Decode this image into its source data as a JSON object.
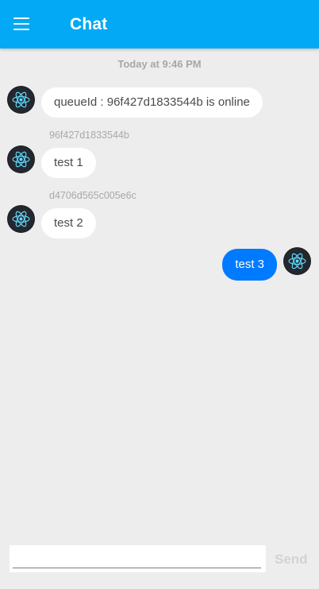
{
  "header": {
    "title": "Chat",
    "menu_icon": "hamburger-menu-icon",
    "background": "#03a9f4"
  },
  "chat": {
    "date_separator": "Today at 9:46 PM",
    "messages": [
      {
        "side": "left",
        "avatar_icon": "react-logo-icon",
        "sender": "",
        "text": "queueId : 96f427d1833544b is online"
      },
      {
        "side": "left",
        "avatar_icon": "react-logo-icon",
        "sender": "96f427d1833544b",
        "text": "test 1"
      },
      {
        "side": "left",
        "avatar_icon": "react-logo-icon",
        "sender": "d4706d565c005e6c",
        "text": "test 2"
      },
      {
        "side": "right",
        "avatar_icon": "react-logo-icon",
        "sender": "",
        "text": "test 3"
      }
    ]
  },
  "composer": {
    "value": "",
    "placeholder": "",
    "send_label": "Send"
  },
  "colors": {
    "outgoing_bubble": "#007aff",
    "incoming_bubble": "#ffffff",
    "send_disabled": "#d3d3d3",
    "background": "#ededed"
  }
}
